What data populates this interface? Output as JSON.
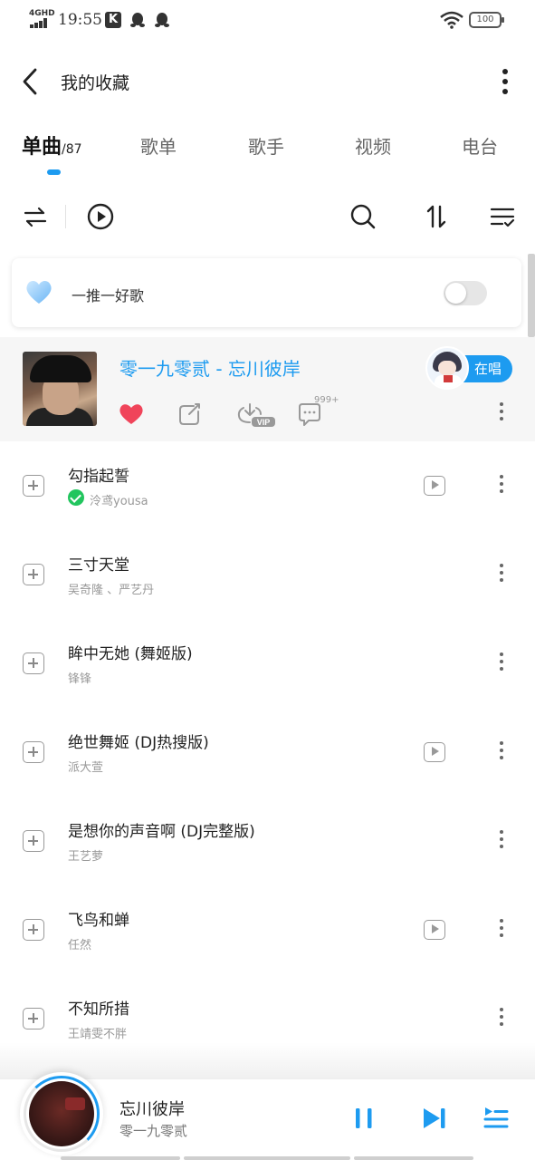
{
  "status_bar": {
    "network": "4GHD",
    "time": "19:55",
    "k_app": "K",
    "battery": "100"
  },
  "header": {
    "title": "我的收藏"
  },
  "tabs": [
    {
      "label": "单曲",
      "count": "/87",
      "active": true
    },
    {
      "label": "歌单"
    },
    {
      "label": "歌手"
    },
    {
      "label": "视频"
    },
    {
      "label": "电台"
    }
  ],
  "recommend": {
    "label": "一推一好歌",
    "enabled": false
  },
  "playing": {
    "title": "零一九零贰 - 忘川彼岸",
    "singer_chip": "在唱",
    "comment_count": "999+",
    "download_badge": "VIP",
    "liked": true
  },
  "songs": [
    {
      "title": "勾指起誓",
      "artist": "泠鸢yousa",
      "verified": true,
      "has_mv": true
    },
    {
      "title": "三寸天堂",
      "artist": "吴奇隆 、严艺丹",
      "verified": false,
      "has_mv": false
    },
    {
      "title": "眸中无她 (舞姬版)",
      "artist": "锋锋",
      "verified": false,
      "has_mv": false
    },
    {
      "title": "绝世舞姬 (DJ热搜版)",
      "artist": "派大萱",
      "verified": false,
      "has_mv": true
    },
    {
      "title": "是想你的声音啊 (DJ完整版)",
      "artist": "王艺萝",
      "verified": false,
      "has_mv": false
    },
    {
      "title": "飞鸟和蝉",
      "artist": "任然",
      "verified": false,
      "has_mv": true
    },
    {
      "title": "不知所措",
      "artist": "王靖雯不胖",
      "verified": false,
      "has_mv": false
    }
  ],
  "mini_player": {
    "title": "忘川彼岸",
    "artist": "零一九零贰",
    "state": "playing"
  },
  "colors": {
    "accent": "#1d9bf0",
    "heart": "#f0445a",
    "verified": "#22c55e"
  }
}
